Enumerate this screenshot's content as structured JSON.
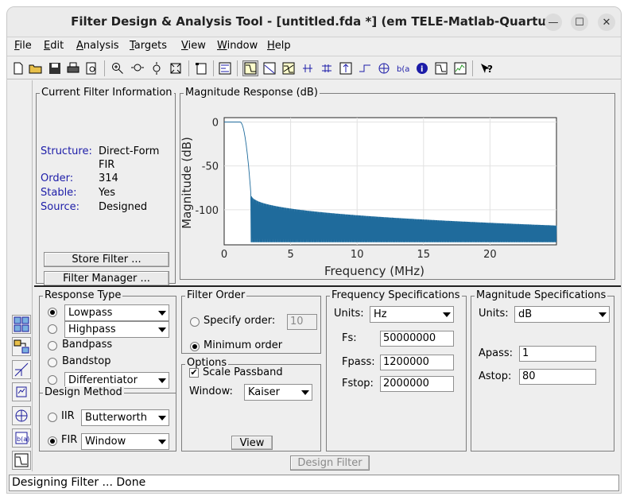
{
  "window": {
    "title": "Filter Design & Analysis Tool -  [untitled.fda *] (em TELE-Matlab-Quartus)"
  },
  "titlebar_buttons": {
    "minimize": "—",
    "maximize": "☐",
    "close": "✕"
  },
  "menu": [
    {
      "ul": "F",
      "rest": "ile"
    },
    {
      "ul": "E",
      "rest": "dit"
    },
    {
      "ul": "A",
      "rest": "nalysis"
    },
    {
      "ul": "T",
      "rest": "argets"
    },
    {
      "ul": "V",
      "rest": "iew"
    },
    {
      "ul": "W",
      "rest": "indow"
    },
    {
      "ul": "H",
      "rest": "elp"
    }
  ],
  "current_filter": {
    "title": "Current Filter Information",
    "structure_label": "Structure:",
    "structure_value_1": "Direct-Form",
    "structure_value_2": "FIR",
    "order_label": "Order:",
    "order_value": "314",
    "stable_label": "Stable:",
    "stable_value": "Yes",
    "source_label": "Source:",
    "source_value": "Designed",
    "store_button": "Store Filter ...",
    "manager_button": "Filter Manager ..."
  },
  "magnitude_panel": {
    "title": "Magnitude Response (dB)"
  },
  "chart_data": {
    "type": "line",
    "title": "",
    "xlabel": "Frequency (MHz)",
    "ylabel": "Magnitude (dB)",
    "xlim": [
      0,
      25
    ],
    "ylim": [
      -140,
      5
    ],
    "xticks": [
      0,
      5,
      10,
      15,
      20
    ],
    "yticks": [
      0,
      -50,
      -100
    ],
    "grid": true,
    "line_color": "#1f6b9c",
    "passband_edge": 1.2,
    "stopband_edge": 2.0,
    "stopband_start_db": -80,
    "stopband_end_db": -118,
    "floor_db": -137
  },
  "response_type": {
    "title": "Response Type",
    "options": [
      "Lowpass",
      "Highpass",
      "Bandpass",
      "Bandstop",
      "Differentiator"
    ],
    "selected": "Lowpass",
    "lowpass_combo": "Lowpass",
    "highpass_combo": "Highpass",
    "differentiator_combo": "Differentiator"
  },
  "design_method": {
    "title": "Design Method",
    "iir_label": "IIR",
    "iir_combo": "Butterworth",
    "fir_label": "FIR",
    "fir_combo": "Window",
    "selected": "FIR"
  },
  "filter_order": {
    "title": "Filter Order",
    "specify_label": "Specify order:",
    "specify_value": "10",
    "minimum_label": "Minimum order",
    "selected": "Minimum order"
  },
  "options": {
    "title": "Options",
    "scale_passband_label": "Scale Passband",
    "scale_passband_check": "✔",
    "window_label": "Window:",
    "window_value": "Kaiser",
    "view_button": "View"
  },
  "frequency_specs": {
    "title": "Frequency Specifications",
    "units_label": "Units:",
    "units_value": "Hz",
    "fs_label": "Fs:",
    "fs_value": "50000000",
    "fpass_label": "Fpass:",
    "fpass_value": "1200000",
    "fstop_label": "Fstop:",
    "fstop_value": "2000000"
  },
  "magnitude_specs": {
    "title": "Magnitude Specifications",
    "units_label": "Units:",
    "units_value": "dB",
    "apass_label": "Apass:",
    "apass_value": "1",
    "astop_label": "Astop:",
    "astop_value": "80"
  },
  "design_button": "Design Filter",
  "status": "Designing Filter ... Done"
}
